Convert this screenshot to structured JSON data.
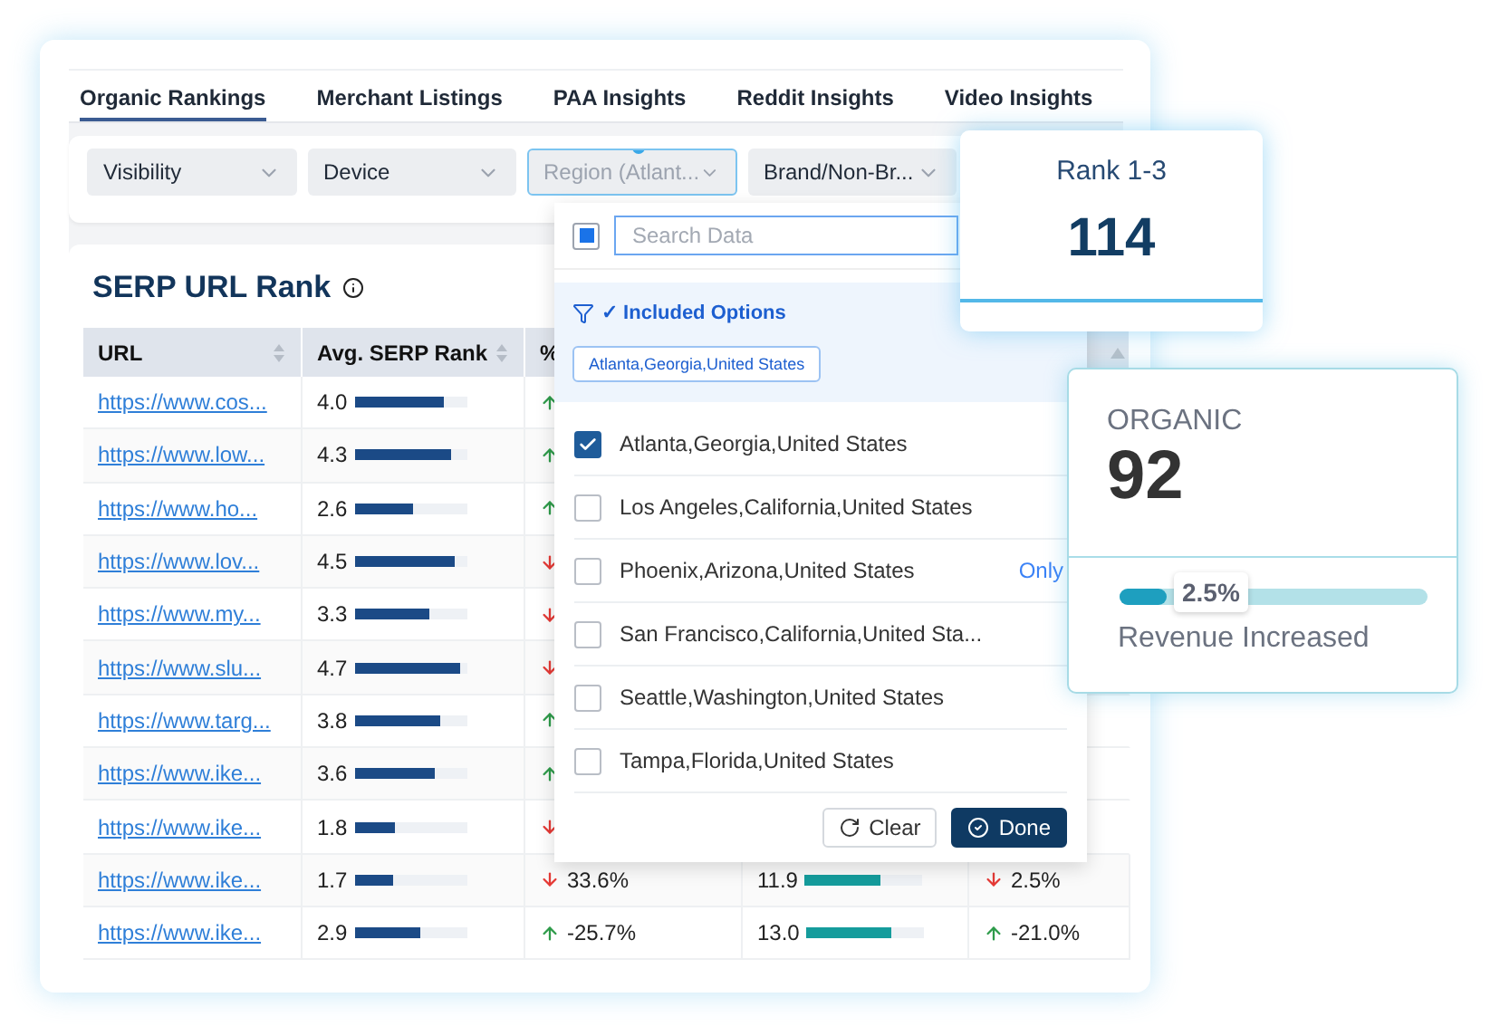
{
  "tabs": [
    {
      "label": "Organic Rankings",
      "selected": true
    },
    {
      "label": "Merchant Listings",
      "selected": false
    },
    {
      "label": "PAA Insights",
      "selected": false
    },
    {
      "label": "Reddit Insights",
      "selected": false
    },
    {
      "label": "Video Insights",
      "selected": false
    }
  ],
  "filters": [
    {
      "label": "Visibility",
      "open": false
    },
    {
      "label": "Device",
      "open": false
    },
    {
      "label": "Region (Atlant...",
      "open": true
    },
    {
      "label": "Brand/Non-Br...",
      "open": false
    }
  ],
  "table": {
    "title": "SERP URL Rank",
    "columns": [
      "URL",
      "Avg. SERP Rank",
      "%"
    ],
    "rows": [
      {
        "url": "https://www.cos...",
        "rank": {
          "text": "4.0",
          "level": 0.8
        },
        "change": {
          "up": true
        }
      },
      {
        "url": "https://www.low...",
        "rank": {
          "text": "4.3",
          "level": 0.86
        },
        "change": {
          "up": true
        }
      },
      {
        "url": "https://www.ho...",
        "rank": {
          "text": "2.6",
          "level": 0.52
        },
        "change": {
          "up": true
        }
      },
      {
        "url": "https://www.lov...",
        "rank": {
          "text": "4.5",
          "level": 0.9
        },
        "change": {
          "up": false
        }
      },
      {
        "url": "https://www.my...",
        "rank": {
          "text": "3.3",
          "level": 0.66
        },
        "change": {
          "up": false
        }
      },
      {
        "url": "https://www.slu...",
        "rank": {
          "text": "4.7",
          "level": 0.94
        },
        "change": {
          "up": false
        }
      },
      {
        "url": "https://www.targ...",
        "rank": {
          "text": "3.8",
          "level": 0.76
        },
        "change": {
          "up": true
        }
      },
      {
        "url": "https://www.ike...",
        "rank": {
          "text": "3.6",
          "level": 0.72
        },
        "change": {
          "up": true
        }
      },
      {
        "url": "https://www.ike...",
        "rank": {
          "text": "1.8",
          "level": 0.36
        },
        "change": {
          "up": false
        }
      },
      {
        "url": "https://www.ike...",
        "rank": {
          "text": "1.7",
          "level": 0.34
        },
        "change": {
          "up": false,
          "text": "33.6%"
        },
        "column_4": {
          "text": "11.9",
          "level": 0.64
        },
        "column_5": {
          "up": false,
          "text": "2.5%"
        }
      },
      {
        "url": "https://www.ike...",
        "rank": {
          "text": "2.9",
          "level": 0.58
        },
        "change": {
          "up": true,
          "text": "-25.7%"
        },
        "column_4": {
          "text": "13.0",
          "level": 0.72
        },
        "column_5": {
          "up": true,
          "text": "-21.0%"
        }
      }
    ]
  },
  "dropdown": {
    "select_all_partial": true,
    "search_placeholder": "Search Data",
    "included_title": "✓ Included Options",
    "included_tags": [
      "Atlanta,Georgia,United States"
    ],
    "options": [
      {
        "label": "Atlanta,Georgia,United States",
        "checked": true
      },
      {
        "label": "Los Angeles,California,United States",
        "checked": false
      },
      {
        "label": "Phoenix,Arizona,United States",
        "checked": false,
        "action": "Only"
      },
      {
        "label": "San Francisco,California,United Sta...",
        "checked": false
      },
      {
        "label": "Seattle,Washington,United States",
        "checked": false
      },
      {
        "label": "Tampa,Florida,United States",
        "checked": false
      }
    ],
    "clear": "Clear",
    "done": "Done"
  },
  "rank_card": {
    "label": "Rank 1-3",
    "value": "114"
  },
  "organic_card": {
    "label": "ORGANIC",
    "value": "92",
    "level": 0.15,
    "reading": "2.5%",
    "caption": "Revenue Increased"
  }
}
